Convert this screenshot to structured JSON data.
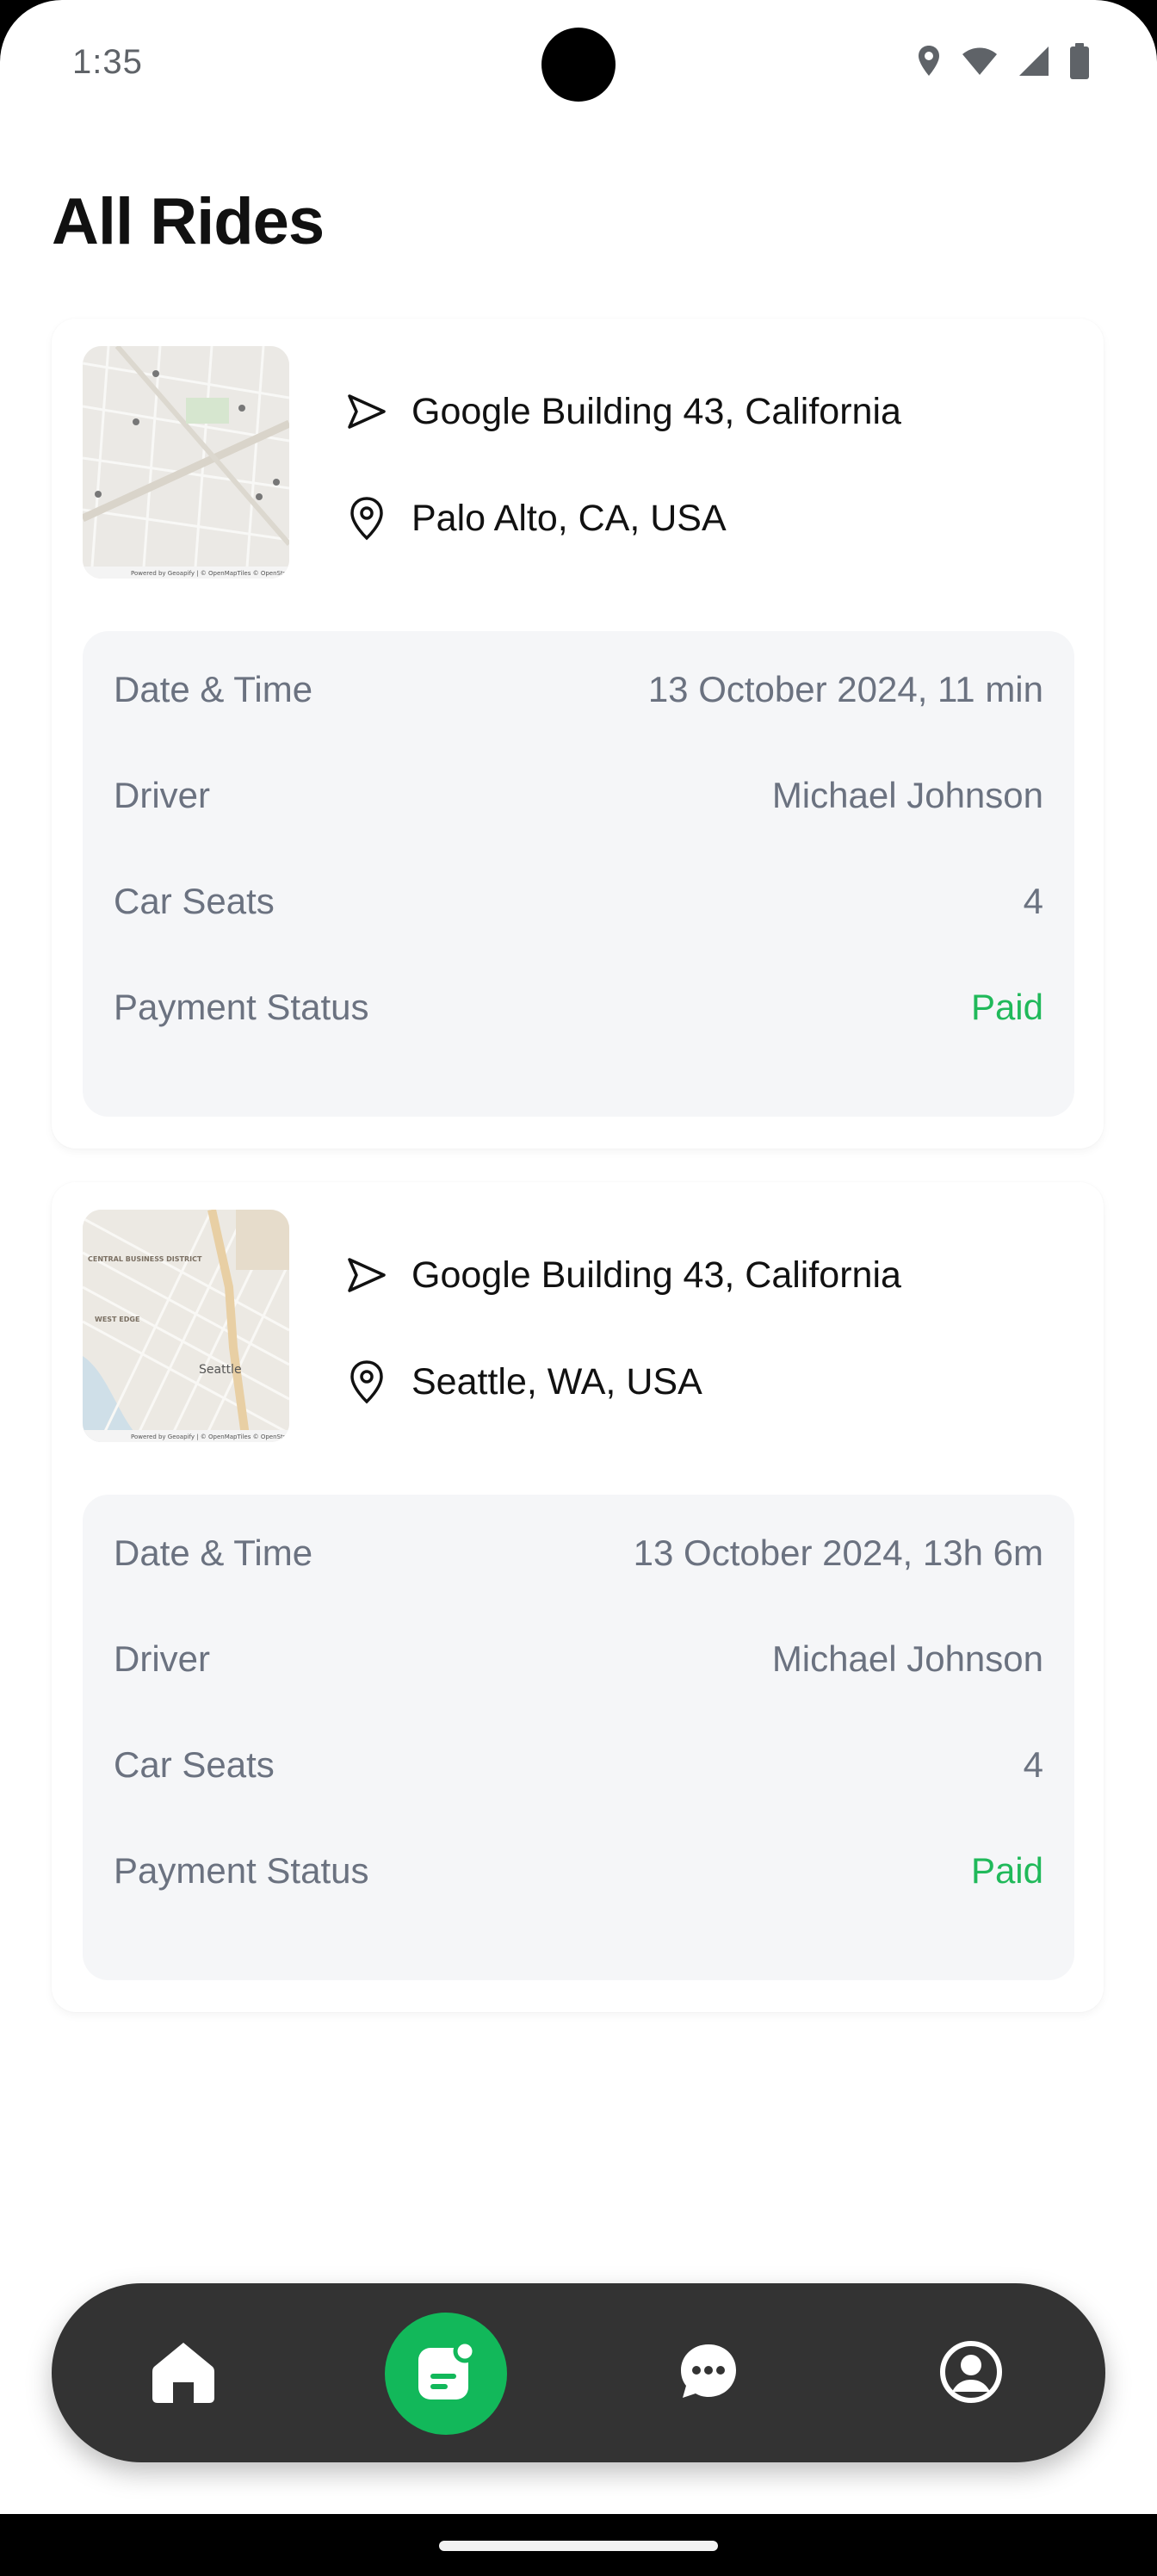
{
  "status_bar": {
    "time": "1:35",
    "icons": [
      "location-icon",
      "wifi-icon",
      "signal-icon",
      "battery-icon"
    ]
  },
  "page": {
    "title": "All Rides"
  },
  "rides": [
    {
      "from": "Google Building 43, California",
      "to": "Palo Alto, CA, USA",
      "map_attribution": "Powered by Geoapify | © OpenMapTiles © OpenStreetMap",
      "details": [
        {
          "label": "Date & Time",
          "value": "13 October 2024, 11 min"
        },
        {
          "label": "Driver",
          "value": "Michael Johnson"
        },
        {
          "label": "Car Seats",
          "value": "4"
        },
        {
          "label": "Payment Status",
          "value": "Paid"
        }
      ]
    },
    {
      "from": "Google Building 43, California",
      "to": "Seattle, WA, USA",
      "map_attribution": "Powered by Geoapify | © OpenMapTiles © OpenStreetMap",
      "map_labels": [
        "CENTRAL BUSINESS DISTRICT",
        "WEST EDGE",
        "Seattle"
      ],
      "details": [
        {
          "label": "Date & Time",
          "value": "13 October 2024, 13h 6m"
        },
        {
          "label": "Driver",
          "value": "Michael Johnson"
        },
        {
          "label": "Car Seats",
          "value": "4"
        },
        {
          "label": "Payment Status",
          "value": "Paid"
        }
      ]
    }
  ],
  "bottom_nav": {
    "items": [
      {
        "icon": "home-icon",
        "active": false
      },
      {
        "icon": "rides-list-icon",
        "active": true
      },
      {
        "icon": "chat-icon",
        "active": false
      },
      {
        "icon": "profile-icon",
        "active": false
      }
    ]
  },
  "colors": {
    "accent": "#12B85A",
    "paid": "#20B95A",
    "nav_background": "#333333",
    "details_background": "#F5F6F8"
  }
}
